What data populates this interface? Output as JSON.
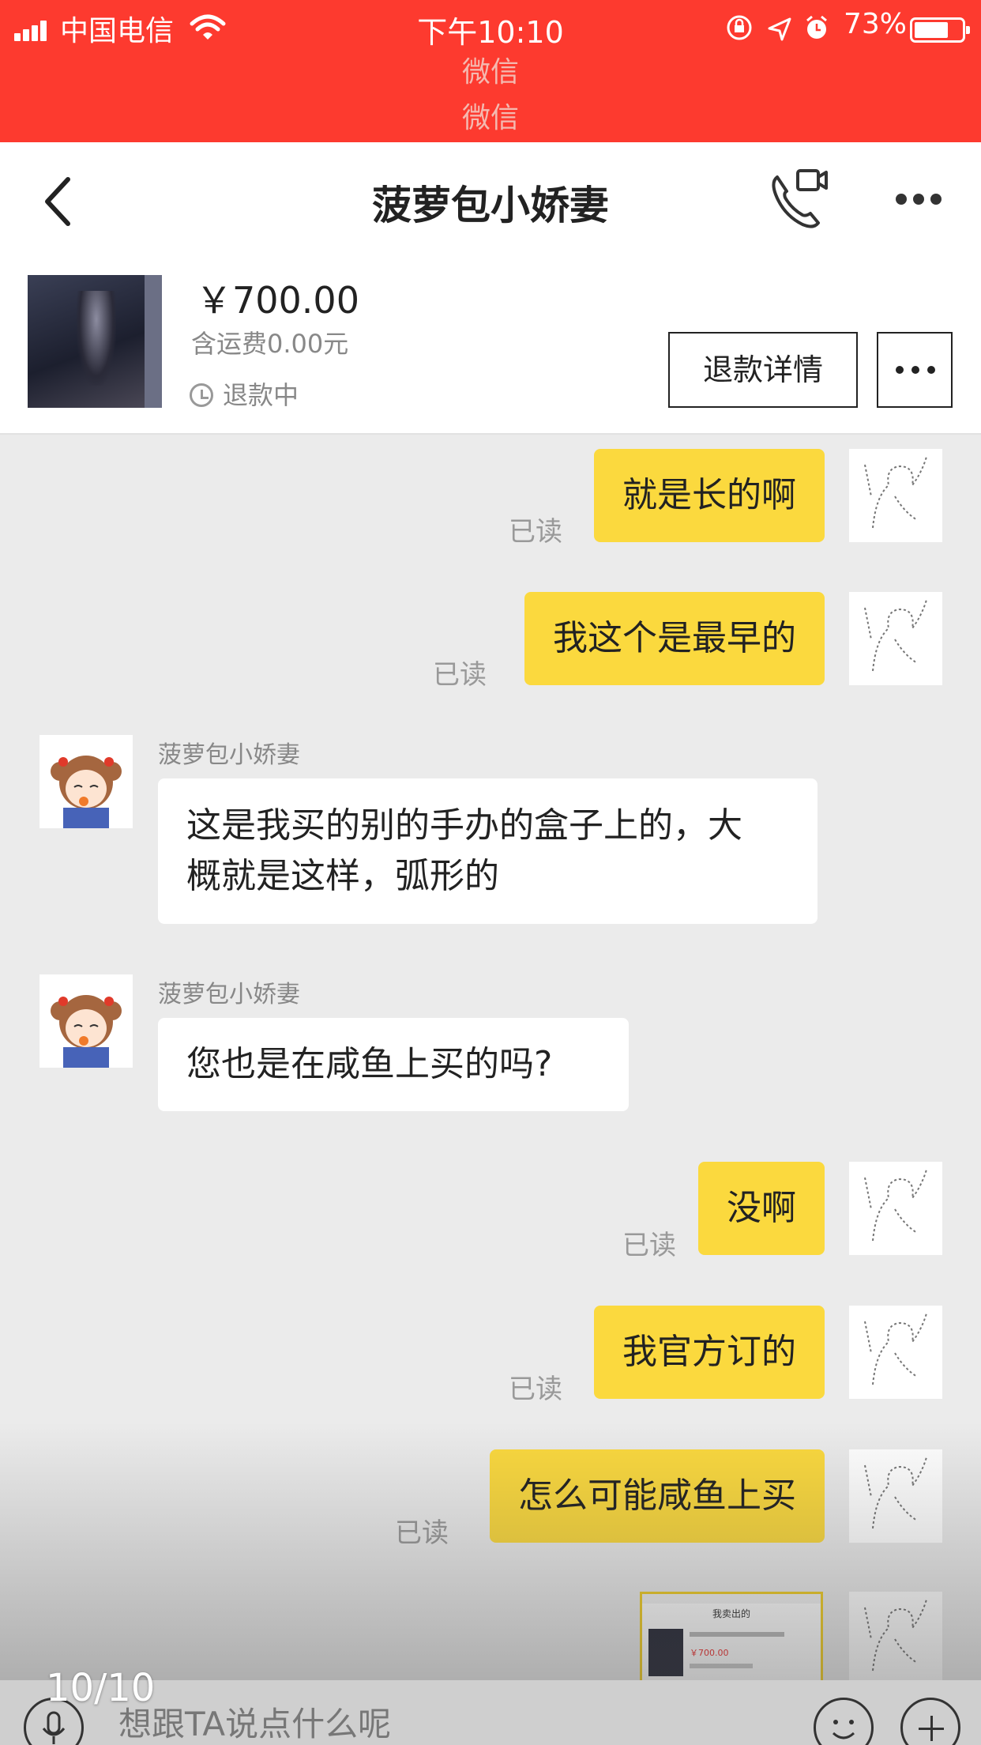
{
  "statusbar": {
    "carrier": "中国电信",
    "time": "下午10:10",
    "battery_pct": "73%",
    "battery_level": 0.73,
    "source_line1": "微信",
    "source_line2": "微信",
    "icons": [
      "signal-icon",
      "wifi-icon",
      "lock-rotation-icon",
      "location-icon",
      "alarm-icon",
      "battery-icon"
    ]
  },
  "header": {
    "title": "菠萝包小娇妻"
  },
  "product": {
    "price": "￥700.00",
    "shipping": "含运费0.00元",
    "status": "退款中",
    "refund_button": "退款详情"
  },
  "messages": [
    {
      "from": "me",
      "text": "就是长的啊",
      "read": "已读"
    },
    {
      "from": "me",
      "text": "我这个是最早的",
      "read": "已读"
    },
    {
      "from": "other",
      "sender": "菠萝包小娇妻",
      "line1": "这是我买的别的手办的盒子上的，大",
      "line2": "概就是这样，弧形的"
    },
    {
      "from": "other",
      "sender": "菠萝包小娇妻",
      "text": "您也是在咸鱼上买的吗?"
    },
    {
      "from": "me",
      "text": "没啊",
      "read": "已读"
    },
    {
      "from": "me",
      "text": "我官方订的",
      "read": "已读"
    },
    {
      "from": "me",
      "text": "怎么可能咸鱼上买",
      "read": "已读"
    }
  ],
  "screenshot_thumb": {
    "title": "我卖出的",
    "price": "￥700.00"
  },
  "input": {
    "placeholder": "想跟TA说点什么呢"
  },
  "page_counter": "10/10",
  "colors": {
    "statusbar_bg": "#fd3a2f",
    "my_bubble": "#fbd93e",
    "chat_bg": "#ebebeb"
  }
}
